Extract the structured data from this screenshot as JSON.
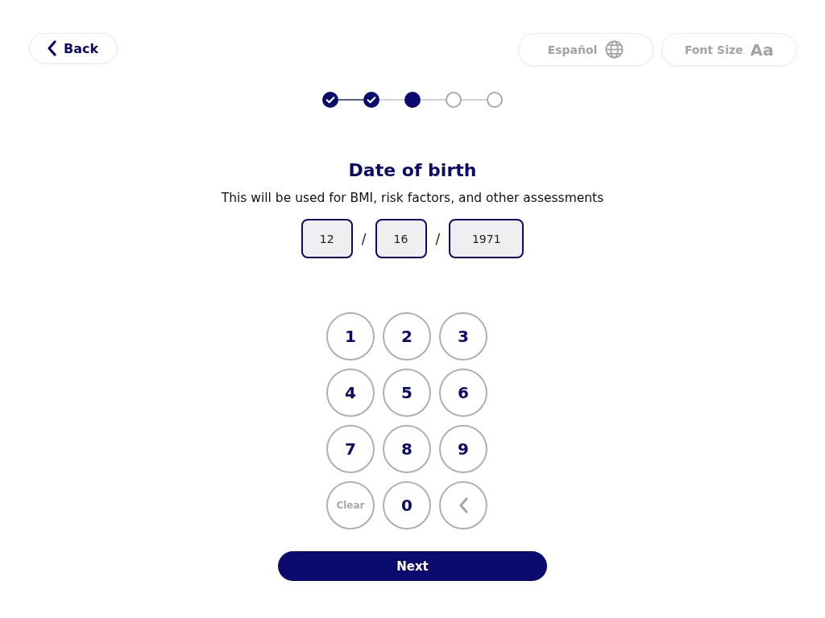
{
  "top_bar": {
    "back_button": {
      "label": "Back"
    },
    "language_button": {
      "label": "Español"
    },
    "font_size_button": {
      "label": "Font Size",
      "sample": "Aa"
    }
  },
  "stepper": [
    {
      "done": true
    },
    {
      "done": true
    },
    {
      "done": false
    },
    {
      "done": false
    },
    {
      "done": false
    }
  ],
  "heading": {
    "title": "Date of birth",
    "subtitle": "This will be used for BMI, risk factors, and other assessments"
  },
  "date_fields": [
    {
      "value": "12",
      "separator": "/"
    },
    {
      "value": "16",
      "separator": "/"
    },
    {
      "value": "1971"
    }
  ],
  "keypad": [
    {
      "kind": "digit",
      "label": "1"
    },
    {
      "kind": "digit",
      "label": "2"
    },
    {
      "kind": "digit",
      "label": "3"
    },
    {
      "kind": "digit",
      "label": "4"
    },
    {
      "kind": "digit",
      "label": "5"
    },
    {
      "kind": "digit",
      "label": "6"
    },
    {
      "kind": "digit",
      "label": "7"
    },
    {
      "kind": "digit",
      "label": "8"
    },
    {
      "kind": "digit",
      "label": "9"
    },
    {
      "kind": "clear",
      "label": "Clear"
    },
    {
      "kind": "digit",
      "label": "0"
    },
    {
      "kind": "backspace"
    }
  ],
  "next_button": {
    "label": "Next"
  }
}
